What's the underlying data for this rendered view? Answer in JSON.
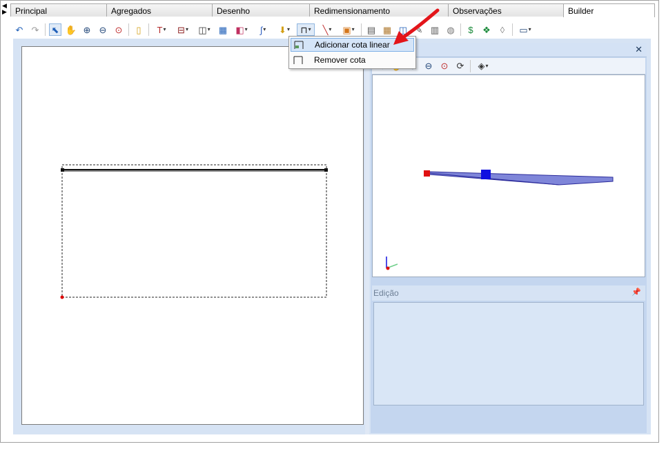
{
  "tabs": [
    {
      "label": "Principal"
    },
    {
      "label": "Agregados"
    },
    {
      "label": "Desenho"
    },
    {
      "label": "Redimensionamento"
    },
    {
      "label": "Observações"
    },
    {
      "label": "Builder"
    }
  ],
  "dropdown": {
    "items": [
      {
        "label": "Adicionar cota linear"
      },
      {
        "label": "Remover cota"
      }
    ]
  },
  "edit_panel": {
    "title": "Edição"
  },
  "toolbar_icons": [
    "undo-icon",
    "redo-icon",
    "select-icon",
    "pan-hand-icon",
    "zoom-in-icon",
    "zoom-out-icon",
    "zoom-fit-icon",
    "new-element-icon",
    "column-icon",
    "beam-icon",
    "wall-icon",
    "stair-icon",
    "material-icon",
    "curve-icon",
    "fill-icon",
    "dimension-icon",
    "line-icon",
    "layers-icon",
    "calc-icon",
    "grid-icon",
    "panels-icon",
    "wrench-icon",
    "document-icon",
    "money-bag-icon",
    "dollar-icon",
    "blocks-icon",
    "eraser-icon",
    "window-icon"
  ],
  "colors": {
    "accent": "#1a3fd6",
    "highlight": "#d5e5f8",
    "panel": "#d6e3f4",
    "arrow": "#e3151a"
  }
}
